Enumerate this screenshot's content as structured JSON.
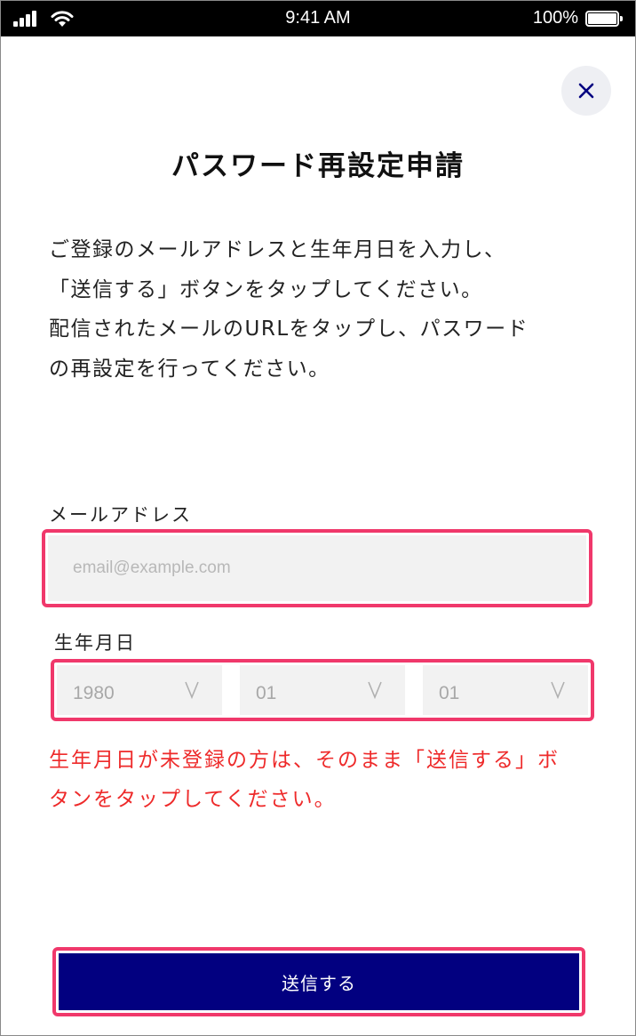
{
  "status_bar": {
    "time": "9:41 AM",
    "battery": "100%"
  },
  "page": {
    "title": "パスワード再設定申請",
    "description_lines": [
      "ご登録のメールアドレスと生年月日を入力し、",
      "「送信する」ボタンをタップしてください。",
      "配信されたメールのURLをタップし、パスワード",
      "の再設定を行ってください。"
    ]
  },
  "form": {
    "email_label": "メールアドレス",
    "email_value": "",
    "email_placeholder": "email@example.com",
    "birthdate_label": "生年月日",
    "birth_year": "1980",
    "birth_month": "01",
    "birth_day": "01",
    "note_lines": [
      "生年月日が未登録の方は、そのまま「送信する」ボ",
      "タンをタップしてください。"
    ],
    "submit_label": "送信する"
  },
  "colors": {
    "primary": "#020080",
    "highlight_border": "#f0386b",
    "error_text": "#ee2a2a",
    "field_bg": "#f2f2f2"
  },
  "icons": {
    "close": "close-icon",
    "dropdown": "chevron-down-icon",
    "signal": "signal-icon",
    "wifi": "wifi-icon",
    "battery": "battery-icon"
  }
}
